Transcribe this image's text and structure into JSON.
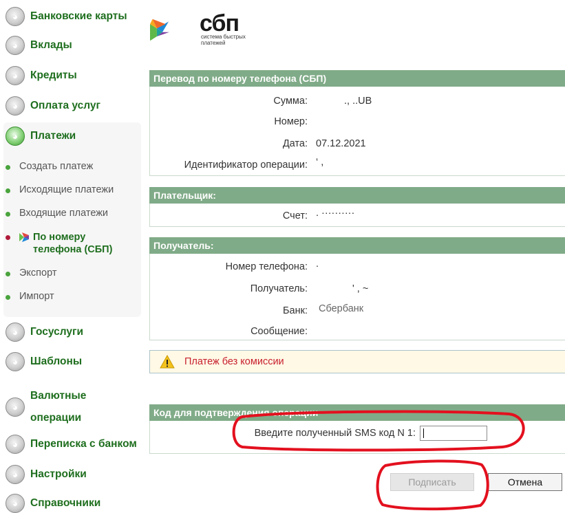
{
  "sidebar": {
    "items": [
      {
        "label": "Банковские карты",
        "icon": "bank-cards-icon"
      },
      {
        "label": "Вклады",
        "icon": "deposits-icon"
      },
      {
        "label": "Кредиты",
        "icon": "credits-icon"
      },
      {
        "label": "Оплата услуг",
        "icon": "services-payment-icon"
      },
      {
        "label": "Платежи",
        "icon": "payments-icon"
      },
      {
        "label": "Госуслуги",
        "icon": "gosuslugi-icon"
      },
      {
        "label": "Шаблоны",
        "icon": "templates-icon"
      },
      {
        "label": "Валютные операции",
        "icon": "currency-icon"
      },
      {
        "label": "Переписка с банком",
        "icon": "correspondence-icon"
      },
      {
        "label": "Настройки",
        "icon": "settings-icon"
      },
      {
        "label": "Справочники",
        "icon": "references-icon"
      }
    ],
    "payments_sub": [
      "Создать платеж",
      "Исходящие платежи",
      "Входящие платежи",
      "По номеру телефона (СБП)",
      "Экспорт",
      "Импорт"
    ],
    "payments_sub_active_line2": "телефона (СБП)",
    "payments_sub_active_line1": "По номеру"
  },
  "logo": {
    "name": "сбп",
    "subtitle_line1": "система быстрых",
    "subtitle_line2": "платежей"
  },
  "transfer": {
    "title": "Перевод по номеру телефона (СБП)",
    "amount_label": "Сумма:",
    "amount_value": "., ..UB",
    "number_label": "Номер:",
    "number_value": "",
    "date_label": "Дата:",
    "date_value": "07.12.2021",
    "op_id_label": "Идентификатор операции:",
    "op_id_value": "‘ ,"
  },
  "payer": {
    "title": "Плательщик:",
    "account_label": "Счет:",
    "account_value": ". ··········"
  },
  "recipient": {
    "title": "Получатель:",
    "phone_label": "Номер телефона:",
    "phone_value": ".",
    "name_label": "Получатель:",
    "name_value": "' ,   ~",
    "bank_label": "Банк:",
    "bank_value": "Сбербанк",
    "message_label": "Сообщение:",
    "message_value": ""
  },
  "notice": {
    "text": "Платеж без комиссии",
    "icon": "warning-icon"
  },
  "confirm": {
    "title": "Код для подтверждения операции",
    "sms_label": "Введите полученный SMS код N 1:",
    "sms_value": ""
  },
  "buttons": {
    "sign": "Подписать",
    "cancel": "Отмена"
  },
  "colors": {
    "nav_green": "#1e6e1e",
    "panel_header": "#80ab88",
    "notice_text": "#c8202e",
    "annotation": "#e3101e"
  }
}
